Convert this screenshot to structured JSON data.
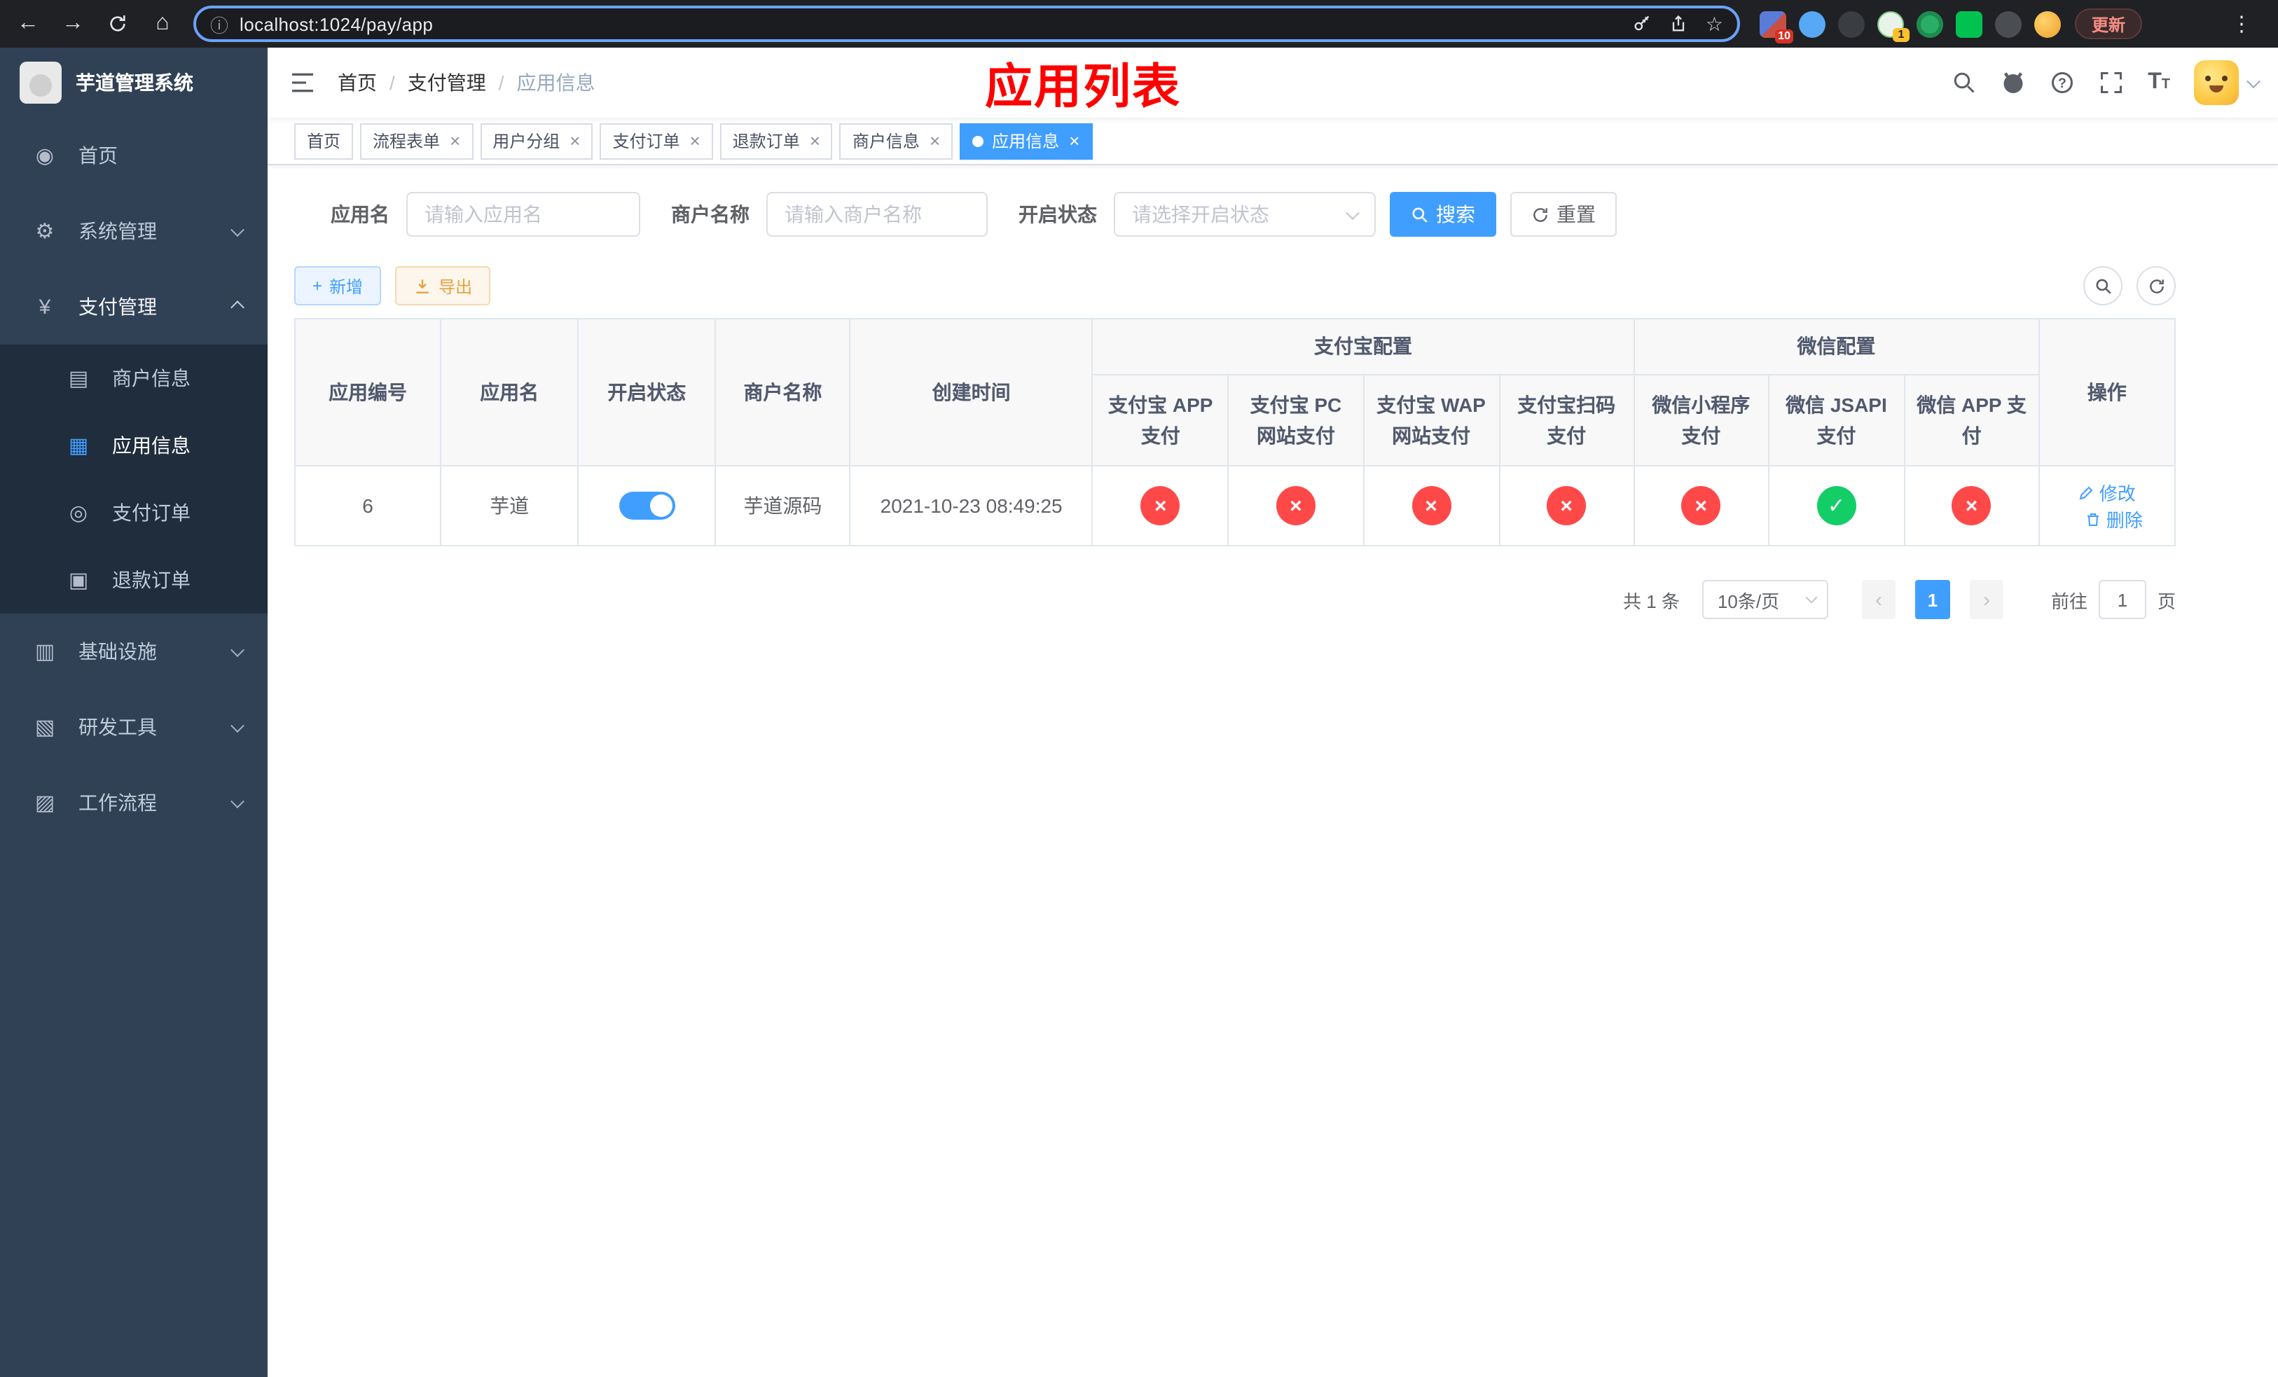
{
  "colors": {
    "accent": "#409eff",
    "danger": "#ff4949",
    "success": "#13ce66",
    "title-red": "#ff0000",
    "sidebar-bg": "#304156",
    "submenu-bg": "#1f2d3d"
  },
  "icons": {
    "back": "←",
    "forward": "→",
    "home": "⌂",
    "info": "ⓘ",
    "star": "☆",
    "dots": "⋮",
    "dashboard": "◉",
    "gear": "⚙",
    "yen": "¥",
    "card": "▤",
    "grid": "▦",
    "order": "◎",
    "refund": "▣",
    "infra": "▥",
    "tools": "▧",
    "workflow": "▨",
    "plus": "+"
  },
  "browser": {
    "url": "localhost:1024/pay/app",
    "update_label": "更新",
    "badge_first": "10",
    "badge_second": "1"
  },
  "sidebar": {
    "logo_title": "芋道管理系统",
    "menu": [
      {
        "label": "首页"
      },
      {
        "label": "系统管理"
      },
      {
        "label": "支付管理"
      },
      {
        "label": "基础设施"
      },
      {
        "label": "研发工具"
      },
      {
        "label": "工作流程"
      }
    ],
    "payment_submenu": [
      {
        "label": "商户信息"
      },
      {
        "label": "应用信息"
      },
      {
        "label": "支付订单"
      },
      {
        "label": "退款订单"
      }
    ]
  },
  "header": {
    "breadcrumb": [
      "首页",
      "支付管理",
      "应用信息"
    ],
    "page_title": "应用列表"
  },
  "tabs": [
    {
      "label": "首页",
      "closable": false
    },
    {
      "label": "流程表单",
      "closable": true
    },
    {
      "label": "用户分组",
      "closable": true
    },
    {
      "label": "支付订单",
      "closable": true
    },
    {
      "label": "退款订单",
      "closable": true
    },
    {
      "label": "商户信息",
      "closable": true
    },
    {
      "label": "应用信息",
      "closable": true,
      "active": true
    }
  ],
  "filters": {
    "app_name_label": "应用名",
    "app_name_placeholder": "请输入应用名",
    "merchant_label": "商户名称",
    "merchant_placeholder": "请输入商户名称",
    "status_label": "开启状态",
    "status_placeholder": "请选择开启状态",
    "search": "搜索",
    "reset": "重置"
  },
  "toolbar": {
    "add": "新增",
    "export": "导出"
  },
  "table": {
    "columns": [
      "应用编号",
      "应用名",
      "开启状态",
      "商户名称",
      "创建时间"
    ],
    "group_alipay": "支付宝配置",
    "alipay_columns": [
      "支付宝 APP 支付",
      "支付宝 PC 网站支付",
      "支付宝 WAP 网站支付",
      "支付宝扫码支付"
    ],
    "group_wechat": "微信配置",
    "wechat_columns": [
      "微信小程序支付",
      "微信 JSAPI 支付",
      "微信 APP 支付"
    ],
    "action_column": "操作",
    "rows": [
      {
        "id": "6",
        "name": "芋道",
        "status_on": true,
        "merchant": "芋道源码",
        "created": "2021-10-23 08:49:25",
        "alipay": [
          "no",
          "no",
          "no",
          "no"
        ],
        "wechat": [
          "no",
          "yes",
          "no"
        ],
        "actions": [
          "修改",
          "删除"
        ]
      }
    ]
  },
  "pagination": {
    "total": "共 1 条",
    "page_size": "10条/页",
    "page": "1",
    "goto": "前往",
    "goto_value": "1",
    "unit": "页"
  }
}
